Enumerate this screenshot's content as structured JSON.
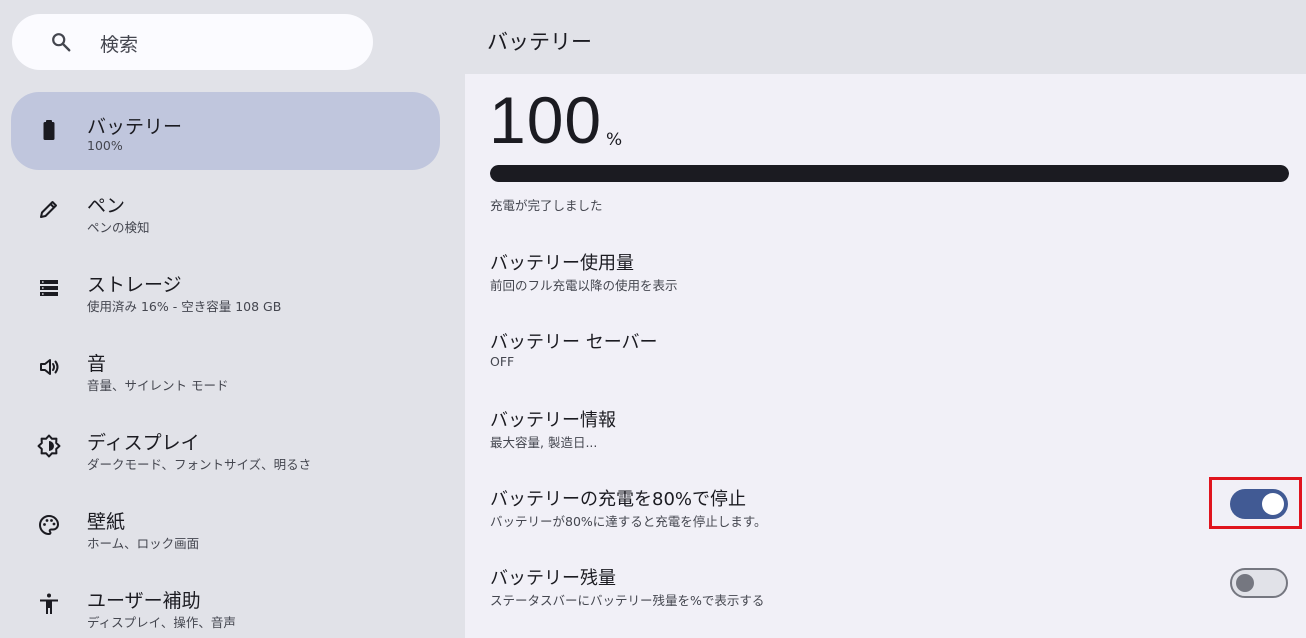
{
  "search": {
    "label": "検索",
    "icon": "search-icon"
  },
  "sidebar": {
    "items": [
      {
        "title": "バッテリー",
        "subtitle": "100%",
        "icon": "battery-icon",
        "selected": true
      },
      {
        "title": "ペン",
        "subtitle": "ペンの検知",
        "icon": "pen-icon",
        "selected": false
      },
      {
        "title": "ストレージ",
        "subtitle": "使用済み 16% - 空き容量 108 GB",
        "icon": "storage-icon",
        "selected": false
      },
      {
        "title": "音",
        "subtitle": "音量、サイレント モード",
        "icon": "volume-icon",
        "selected": false
      },
      {
        "title": "ディスプレイ",
        "subtitle": "ダークモード、フォントサイズ、明るさ",
        "icon": "brightness-icon",
        "selected": false
      },
      {
        "title": "壁紙",
        "subtitle": "ホーム、ロック画面",
        "icon": "palette-icon",
        "selected": false
      },
      {
        "title": "ユーザー補助",
        "subtitle": "ディスプレイ、操作、音声",
        "icon": "accessibility-icon",
        "selected": false
      }
    ]
  },
  "main": {
    "title": "バッテリー",
    "level_value": "100",
    "level_unit": "%",
    "level_fraction": 1.0,
    "status": "充電が完了しました",
    "prefs": [
      {
        "title": "バッテリー使用量",
        "summary": "前回のフル充電以降の使用を表示"
      },
      {
        "title": "バッテリー セーバー",
        "summary": "OFF"
      },
      {
        "title": "バッテリー情報",
        "summary": "最大容量, 製造日..."
      },
      {
        "title": "バッテリーの充電を80%で停止",
        "summary": "バッテリーが80%に達すると充電を停止します。",
        "toggle": true
      },
      {
        "title": "バッテリー残量",
        "summary": "ステータスバーにバッテリー残量を%で表示する",
        "toggle": false
      }
    ]
  },
  "colors": {
    "accent": "#415a94",
    "selected_bg": "#c0c6dd",
    "highlight": "#e0141e"
  }
}
